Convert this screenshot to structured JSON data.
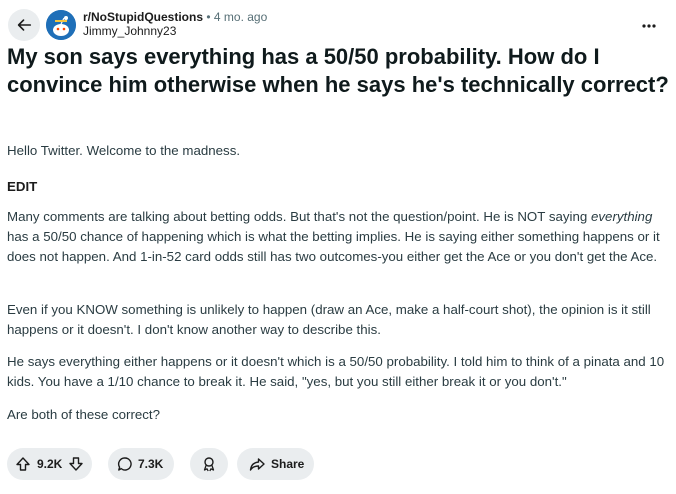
{
  "post": {
    "subreddit": "r/NoStupidQuestions",
    "separator": "•",
    "age": "4 mo. ago",
    "author": "Jimmy_Johnny23",
    "title": "My son says everything has a 50/50 probability. How do I convince him otherwise when he says he's technically correct?",
    "body": {
      "intro": "Hello Twitter. Welcome to the madness.",
      "edit_label": "EDIT",
      "p1_before": "Many comments are talking about betting odds. But that's not the question/point. He is NOT saying ",
      "p1_em": "everything",
      "p1_after": " has a 50/50 chance of happening which is what the betting implies. He is saying either something happens or it does not happen. And 1-in-52 card odds still has two outcomes-you either get the Ace or you don't get the Ace.",
      "p2": "Even if you KNOW something is unlikely to happen (draw an Ace, make a half-court shot), the opinion is it still happens or it doesn't. I don't know another way to describe this.",
      "p3": "He says everything either happens or it doesn't which is a 50/50 probability. I told him to think of a pinata and 10 kids. You have a 1/10 chance to break it. He said, \"yes, but you still either break it or you don't.\"",
      "p4": "Are both of these correct?"
    },
    "actions": {
      "votes": "9.2K",
      "comments": "7.3K",
      "share_label": "Share"
    }
  },
  "icons": {
    "back": "arrow-left-icon",
    "more": "ellipsis-icon",
    "upvote": "arrow-up-icon",
    "downvote": "arrow-down-icon",
    "comment": "speech-bubble-icon",
    "award": "award-icon",
    "share": "share-arrow-icon"
  },
  "colors": {
    "pill_background": "#eaedef",
    "avatar": "#1f6fb8",
    "meta_gray": "#576f76"
  }
}
